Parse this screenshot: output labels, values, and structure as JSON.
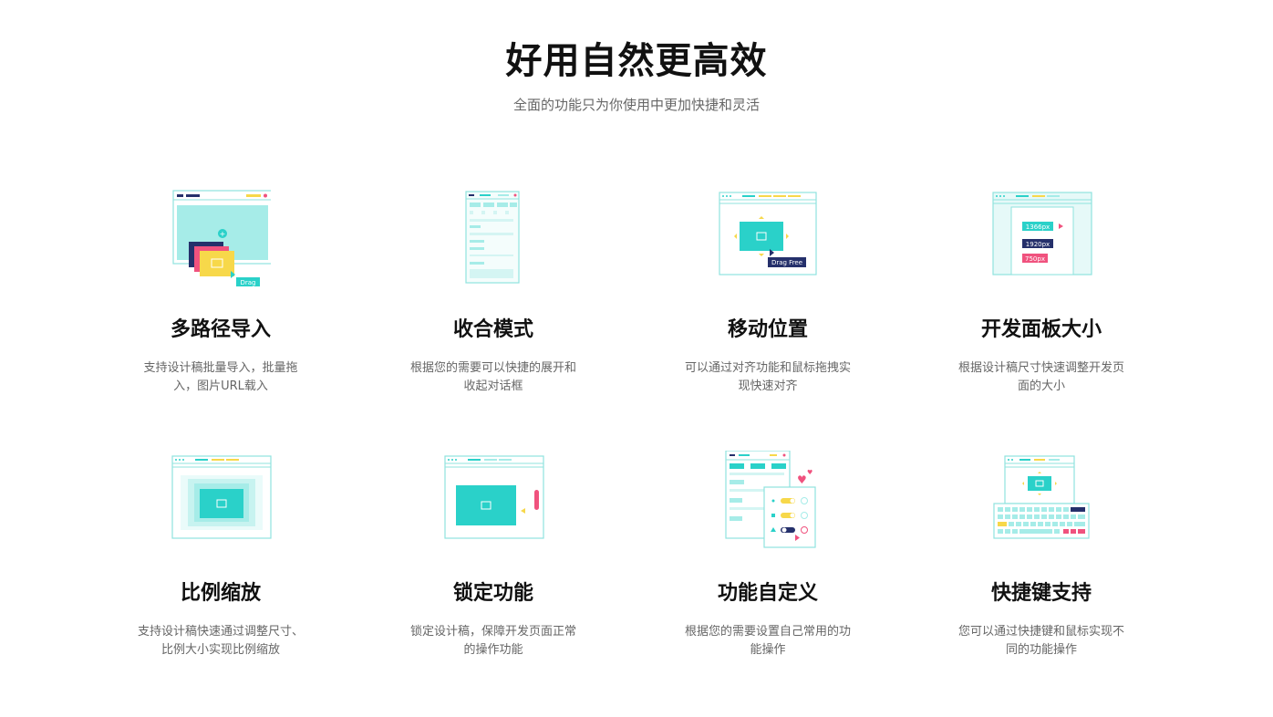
{
  "header": {
    "title": "好用自然更高效",
    "subtitle": "全面的功能只为你使用中更加快捷和灵活"
  },
  "features": [
    {
      "title": "多路径导入",
      "desc": "支持设计稿批量导入，批量拖入，图片URL载入",
      "illustration": "multi-import-illustration",
      "badge": "Drag"
    },
    {
      "title": "收合模式",
      "desc": "根据您的需要可以快捷的展开和收起对话框",
      "illustration": "collapse-mode-illustration"
    },
    {
      "title": "移动位置",
      "desc": "可以通过对齐功能和鼠标拖拽实现快速对齐",
      "illustration": "move-position-illustration",
      "badge": "Drag Free"
    },
    {
      "title": "开发面板大小",
      "desc": "根据设计稿尺寸快速调整开发页面的大小",
      "illustration": "panel-size-illustration",
      "sizes": [
        "1366px",
        "1920px",
        "750px"
      ]
    },
    {
      "title": "比例缩放",
      "desc": "支持设计稿快速通过调整尺寸、比例大小实现比例缩放",
      "illustration": "scale-illustration"
    },
    {
      "title": "锁定功能",
      "desc": "锁定设计稿，保障开发页面正常的操作功能",
      "illustration": "lock-illustration"
    },
    {
      "title": "功能自定义",
      "desc": "根据您的需要设置自己常用的功能操作",
      "illustration": "customize-illustration"
    },
    {
      "title": "快捷键支持",
      "desc": "您可以通过快捷键和鼠标实现不同的功能操作",
      "illustration": "shortcut-illustration"
    }
  ],
  "colors": {
    "teal": "#2ad1c9",
    "light_teal": "#a6ece8",
    "navy": "#25306b",
    "pink": "#f0527e",
    "yellow": "#f7d84a",
    "text_dark": "#111111",
    "text_muted": "#666666"
  }
}
